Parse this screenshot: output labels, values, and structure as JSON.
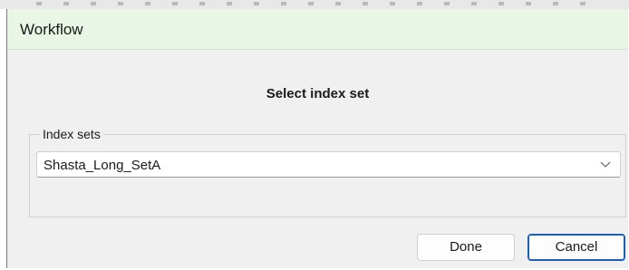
{
  "window": {
    "title": "Workflow"
  },
  "dialog": {
    "heading": "Select index set",
    "group_label": "Index sets",
    "selected_index_set": "Shasta_Long_SetA"
  },
  "buttons": {
    "done_label": "Done",
    "cancel_label": "Cancel"
  },
  "icons": {
    "dropdown": "chevron-down-icon"
  },
  "colors": {
    "titlebar_bg": "#e9f5e5",
    "dialog_bg": "#f0f0f0",
    "default_button_border": "#1a5fb4"
  }
}
